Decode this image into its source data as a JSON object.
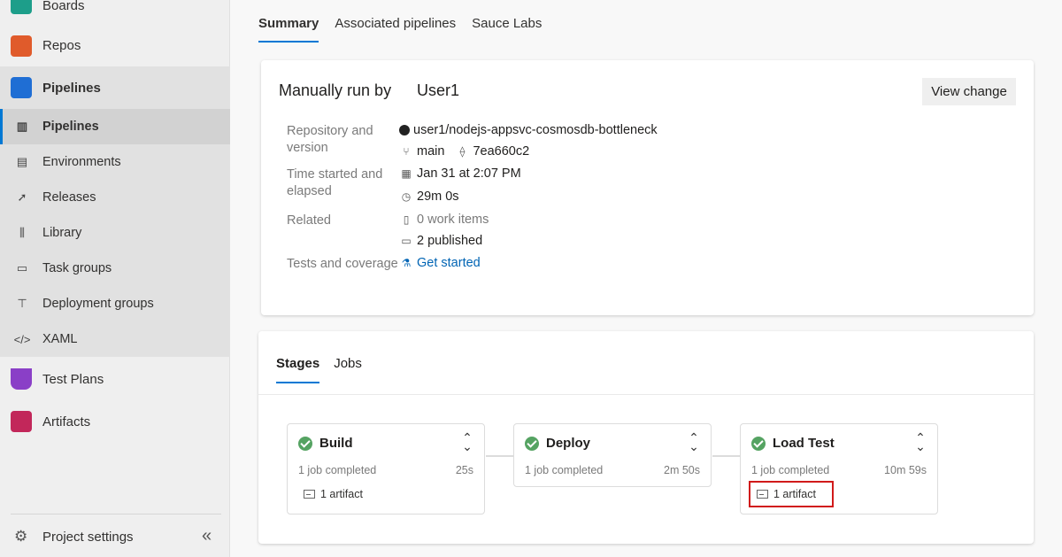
{
  "sidebar": {
    "top_items": [
      {
        "label": "Boards",
        "icon": "boards-icon",
        "color": "#1d9e8a"
      },
      {
        "label": "Repos",
        "icon": "repos-icon",
        "color": "#e05b2b"
      },
      {
        "label": "Pipelines",
        "icon": "pipelines-icon",
        "color": "#1f6ed4"
      }
    ],
    "sub_items": [
      {
        "label": "Pipelines",
        "icon": "pipelines-sub-icon"
      },
      {
        "label": "Environments",
        "icon": "environments-icon"
      },
      {
        "label": "Releases",
        "icon": "releases-icon"
      },
      {
        "label": "Library",
        "icon": "library-icon"
      },
      {
        "label": "Task groups",
        "icon": "task-groups-icon"
      },
      {
        "label": "Deployment groups",
        "icon": "deployment-groups-icon"
      },
      {
        "label": "XAML",
        "icon": "xaml-icon"
      }
    ],
    "bottom_items": [
      {
        "label": "Test Plans",
        "icon": "test-plans-icon",
        "color": "#8a3fc7"
      },
      {
        "label": "Artifacts",
        "icon": "artifacts-icon",
        "color": "#c2275a"
      }
    ],
    "settings_label": "Project settings"
  },
  "tabs": [
    "Summary",
    "Associated pipelines",
    "Sauce Labs"
  ],
  "summary": {
    "title": "Manually run by",
    "user": "User1",
    "view_change": "View change",
    "labels": {
      "repo": "Repository and version",
      "time": "Time started and elapsed",
      "related": "Related",
      "tests": "Tests and coverage"
    },
    "repo": "user1/nodejs-appsvc-cosmosdb-bottleneck",
    "branch": "main",
    "commit": "7ea660c2",
    "started": "Jan 31 at 2:07 PM",
    "elapsed": "29m 0s",
    "work_items": "0 work items",
    "published": "2 published",
    "tests_link": "Get started"
  },
  "stages_tabs": [
    "Stages",
    "Jobs"
  ],
  "stages": [
    {
      "name": "Build",
      "jobs": "1 job completed",
      "duration": "25s",
      "artifact": "1 artifact"
    },
    {
      "name": "Deploy",
      "jobs": "1 job completed",
      "duration": "2m 50s",
      "artifact": ""
    },
    {
      "name": "Load Test",
      "jobs": "1 job completed",
      "duration": "10m 59s",
      "artifact": "1 artifact"
    }
  ]
}
